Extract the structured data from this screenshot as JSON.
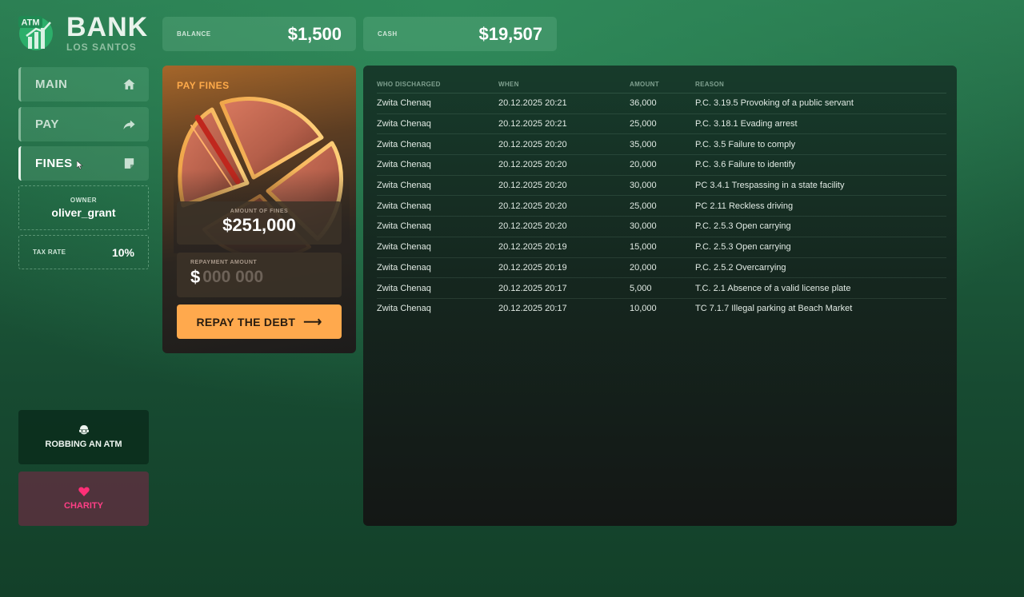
{
  "logo": {
    "badge": "ATM",
    "title": "BANK",
    "subtitle": "LOS SANTOS"
  },
  "stats": {
    "balance": {
      "label": "BALANCE",
      "value": "$1,500"
    },
    "cash": {
      "label": "CASH",
      "value": "$19,507"
    }
  },
  "nav": {
    "items": [
      {
        "label": "MAIN",
        "icon": "home-icon"
      },
      {
        "label": "PAY",
        "icon": "share-arrow-icon"
      },
      {
        "label": "FINES",
        "icon": "note-icon",
        "active": true
      }
    ]
  },
  "owner": {
    "label": "OWNER",
    "value": "oliver_grant"
  },
  "tax": {
    "label": "TAX RATE",
    "value": "10%"
  },
  "side_buttons": {
    "rob": {
      "label": "ROBBING AN ATM",
      "icon": "robber-mask-icon"
    },
    "charity": {
      "label": "CHARITY",
      "icon": "heart-icon"
    }
  },
  "pay_fines": {
    "title": "PAY FINES",
    "amount_label": "AMOUNT OF FINES",
    "amount_value": "$251,000",
    "repay_label": "REPAYMENT AMOUNT",
    "repay_currency": "$",
    "repay_placeholder": "000 000",
    "repay_value": "",
    "button_label": "REPAY THE DEBT",
    "button_arrow": "⟶"
  },
  "fines_table": {
    "headers": [
      "WHO DISCHARGED",
      "WHEN",
      "AMOUNT",
      "REASON"
    ],
    "rows": [
      [
        "Zwita Chenaq",
        "20.12.2025 20:21",
        "36,000",
        "P.C. 3.19.5 Provoking of a public servant"
      ],
      [
        "Zwita Chenaq",
        "20.12.2025 20:21",
        "25,000",
        "P.C. 3.18.1 Evading arrest"
      ],
      [
        "Zwita Chenaq",
        "20.12.2025 20:20",
        "35,000",
        "P.C. 3.5 Failure to comply"
      ],
      [
        "Zwita Chenaq",
        "20.12.2025 20:20",
        "20,000",
        "P.C. 3.6 Failure to identify"
      ],
      [
        "Zwita Chenaq",
        "20.12.2025 20:20",
        "30,000",
        "PC 3.4.1 Trespassing in a state facility"
      ],
      [
        "Zwita Chenaq",
        "20.12.2025 20:20",
        "25,000",
        "PC 2.11 Reckless driving"
      ],
      [
        "Zwita Chenaq",
        "20.12.2025 20:20",
        "30,000",
        "P.C. 2.5.3 Open carrying"
      ],
      [
        "Zwita Chenaq",
        "20.12.2025 20:19",
        "15,000",
        "P.C. 2.5.3 Open carrying"
      ],
      [
        "Zwita Chenaq",
        "20.12.2025 20:19",
        "20,000",
        "P.C. 2.5.2 Overcarrying"
      ],
      [
        "Zwita Chenaq",
        "20.12.2025 20:17",
        "5,000",
        "T.C. 2.1 Absence of a valid license plate"
      ],
      [
        "Zwita Chenaq",
        "20.12.2025 20:17",
        "10,000",
        "TC 7.1.7 Illegal parking at Beach Market"
      ]
    ]
  },
  "colors": {
    "accent_orange": "#ffa94d",
    "title_orange": "#ffab4a",
    "charity_pink": "#ff3f86",
    "brand_green": "#2a7a50"
  }
}
